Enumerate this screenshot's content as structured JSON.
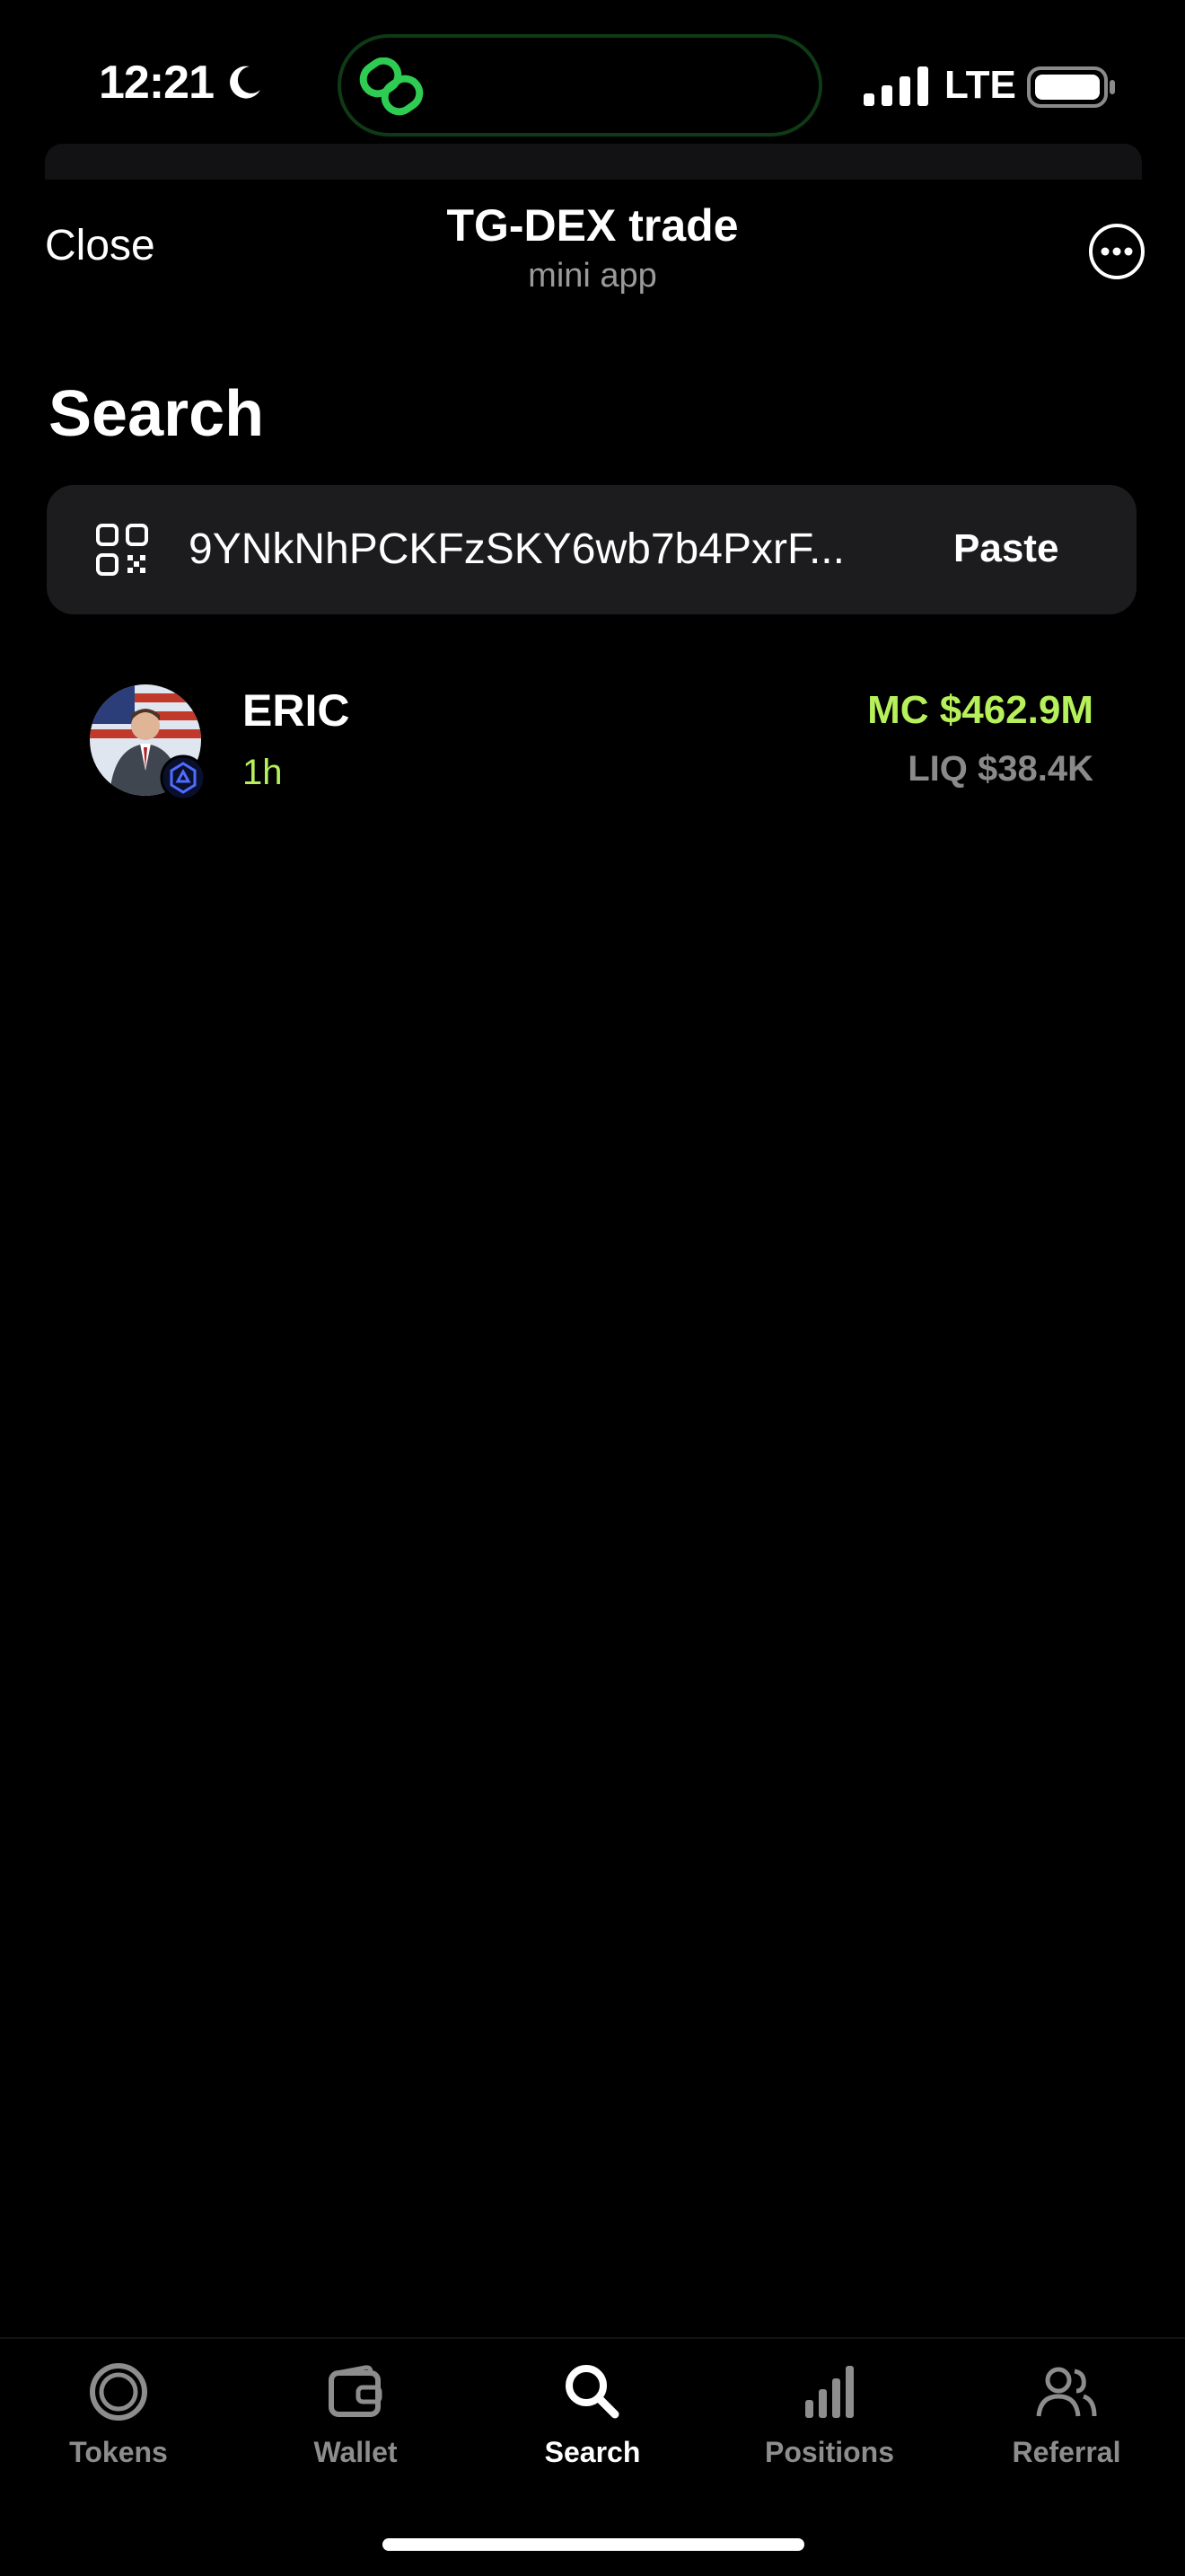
{
  "status_bar": {
    "time": "12:21",
    "network": "LTE",
    "island_icon": "link-chain-icon",
    "accent": "#2ecc52"
  },
  "header": {
    "close_label": "Close",
    "title": "TG-DEX trade",
    "subtitle": "mini app",
    "more_icon": "more-circle-icon"
  },
  "search": {
    "title": "Search",
    "value": "9YNkNhPCKFzSKY6wb7b4PxrF...",
    "paste_label": "Paste",
    "scan_icon": "qr-scan-icon"
  },
  "results": [
    {
      "name": "ERIC",
      "age": "1h",
      "market_cap": "MC $462.9M",
      "liquidity": "LIQ $38.4K",
      "avatar_icon": "token-avatar",
      "chain_icon": "chain-badge-icon"
    }
  ],
  "tabs": [
    {
      "label": "Tokens",
      "icon": "tokens-icon",
      "active": false
    },
    {
      "label": "Wallet",
      "icon": "wallet-icon",
      "active": false
    },
    {
      "label": "Search",
      "icon": "search-icon",
      "active": true
    },
    {
      "label": "Positions",
      "icon": "positions-icon",
      "active": false
    },
    {
      "label": "Referral",
      "icon": "referral-icon",
      "active": false
    }
  ],
  "colors": {
    "background": "#000000",
    "accent_green": "#b6f05a",
    "muted": "#8d8d8d",
    "surface": "#1c1c1e"
  }
}
